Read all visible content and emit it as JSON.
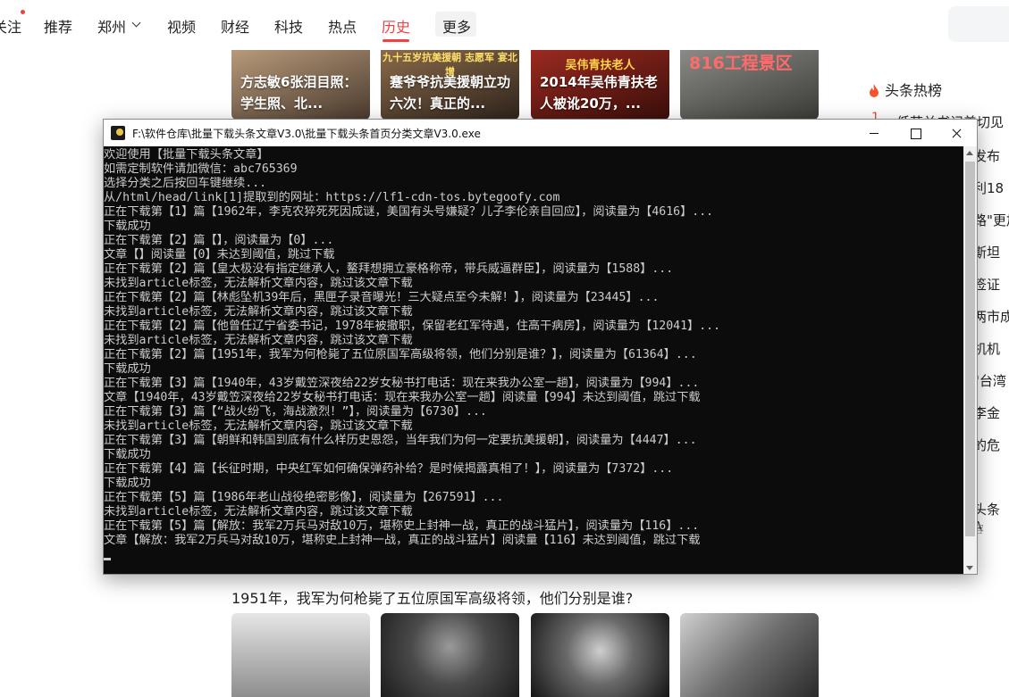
{
  "nav": {
    "items": [
      "关注",
      "推荐",
      "郑州",
      "视频",
      "财经",
      "科技",
      "热点",
      "历史",
      "更多"
    ],
    "active": "历史"
  },
  "thumbs": [
    {
      "caption": "方志敏6张泪目照：学生照、北..."
    },
    {
      "top_text": "九十五岁抗美援朝 志愿军 宴北增",
      "caption": "蹇爷爷抗美援朝立功六次！真正的..."
    },
    {
      "top_text": "吴伟青扶老人",
      "caption": "2014年吴伟青扶老人被讹20万，..."
    },
    {
      "top_text": "816工程景区",
      "caption": ""
    }
  ],
  "sidebar": {
    "hot_title": "头条热榜",
    "first_index": "1",
    "lines": [
      "低劳关书记美切见",
      "发布",
      "利18",
      "路\"更加",
      "斯坦",
      "签证",
      "两市成",
      "机机",
      "\"台湾",
      "李金",
      "的危"
    ],
    "card_title": "头条A",
    "card_sub": "容"
  },
  "console": {
    "title": "F:\\软件仓库\\批量下载头条文章V3.0\\批量下载头条首页分类文章V3.0.exe",
    "lines": [
      "欢迎使用【批量下载头条文章】",
      "如需定制软件请加微信：abc765369",
      "选择分类之后按回车键继续...",
      "从/html/head/link[1]提取到的网址：https://lf1-cdn-tos.bytegoofy.com",
      "正在下载第【1】篇【1962年，李克农猝死死因成谜，美国有头号嫌疑？儿子李伦亲自回应】，阅读量为【4616】...",
      "下载成功",
      "正在下载第【2】篇【】，阅读量为【0】...",
      "文章【】阅读量【0】未达到阈值，跳过下载",
      "正在下载第【2】篇【皇太极没有指定继承人，鳌拜想拥立豪格称帝，带兵威逼群臣】，阅读量为【1588】...",
      "未找到article标签，无法解析文章内容，跳过该文章下载",
      "正在下载第【2】篇【林彪坠机39年后，黑匣子录音曝光！三大疑点至今未解！】，阅读量为【23445】...",
      "未找到article标签，无法解析文章内容，跳过该文章下载",
      "正在下载第【2】篇【他曾任辽宁省委书记，1978年被撤职，保留老红军待遇，住高干病房】，阅读量为【12041】...",
      "未找到article标签，无法解析文章内容，跳过该文章下载",
      "正在下载第【2】篇【1951年，我军为何枪毙了五位原国军高级将领，他们分别是谁？】，阅读量为【61364】...",
      "下载成功",
      "正在下载第【3】篇【1940年，43岁戴笠深夜给22岁女秘书打电话：现在来我办公室一趟】，阅读量为【994】...",
      "文章【1940年，43岁戴笠深夜给22岁女秘书打电话：现在来我办公室一趟】阅读量【994】未达到阈值，跳过下载",
      "正在下载第【3】篇【“战火纷飞，海战激烈！”】，阅读量为【6730】...",
      "未找到article标签，无法解析文章内容，跳过该文章下载",
      "正在下载第【3】篇【朝鲜和韩国到底有什么样历史恩怨，当年我们为何一定要抗美援朝】，阅读量为【4447】...",
      "下载成功",
      "正在下载第【4】篇【长征时期，中央红军如何确保弹药补给？是时候揭露真相了！】，阅读量为【7372】...",
      "下载成功",
      "正在下载第【5】篇【1986年老山战役绝密影像】，阅读量为【267591】...",
      "未找到article标签，无法解析文章内容，跳过该文章下载",
      "正在下载第【5】篇【解放：我军2万兵马对敌10万，堪称史上封神一战，真正的战斗猛片】，阅读量为【116】...",
      "文章【解放：我军2万兵马对敌10万，堪称史上封神一战，真正的战斗猛片】阅读量【116】未达到阈值，跳过下载"
    ]
  },
  "article": {
    "title": "1951年，我军为何枪毙了五位原国军高级将领，他们分别是谁?"
  }
}
